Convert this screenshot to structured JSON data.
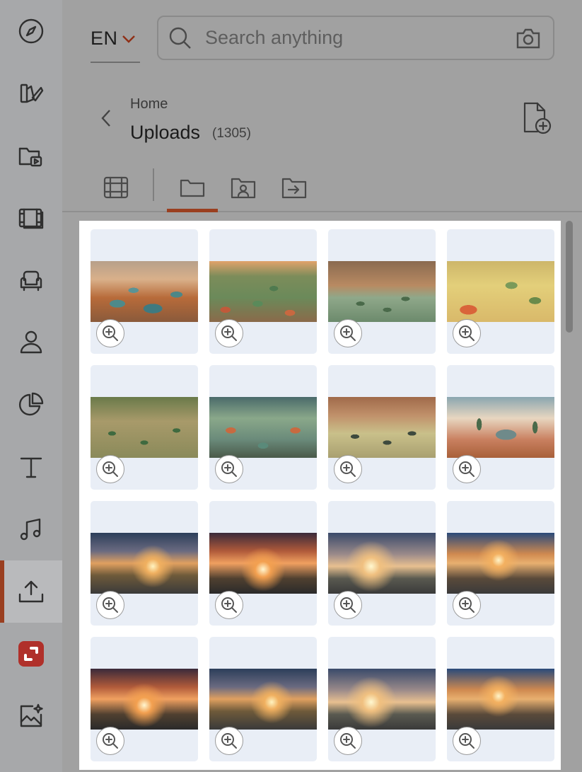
{
  "rail": {
    "items": [
      {
        "name": "explore-icon"
      },
      {
        "name": "design-icon"
      },
      {
        "name": "media-folder-icon"
      },
      {
        "name": "film-icon"
      },
      {
        "name": "armchair-icon"
      },
      {
        "name": "person-icon"
      },
      {
        "name": "pie-chart-icon"
      },
      {
        "name": "text-icon"
      },
      {
        "name": "music-icon"
      },
      {
        "name": "upload-icon",
        "active": true
      },
      {
        "name": "brand-logo-icon"
      },
      {
        "name": "ai-image-icon"
      }
    ]
  },
  "header": {
    "language": "EN",
    "search_placeholder": "Search anything"
  },
  "breadcrumb": {
    "parent": "Home",
    "title": "Uploads",
    "count": "(1305)"
  },
  "tabs": [
    {
      "name": "grid-view-icon"
    },
    {
      "name": "folder-icon",
      "active": true
    },
    {
      "name": "shared-folder-icon"
    },
    {
      "name": "move-to-folder-icon"
    }
  ],
  "colors": {
    "accent": "#9a3f20",
    "card_bg": "#e9eef6"
  },
  "thumbnails": [
    {
      "scene": "mine-a"
    },
    {
      "scene": "mine-b"
    },
    {
      "scene": "mine-c"
    },
    {
      "scene": "mine-d"
    },
    {
      "scene": "mine-e"
    },
    {
      "scene": "mine-f"
    },
    {
      "scene": "mine-g"
    },
    {
      "scene": "mine-h"
    },
    {
      "scene": "sky-a"
    },
    {
      "scene": "sky-b"
    },
    {
      "scene": "sky-c"
    },
    {
      "scene": "sky-d"
    },
    {
      "scene": "sky-b"
    },
    {
      "scene": "sky-a"
    },
    {
      "scene": "sky-c"
    },
    {
      "scene": "sky-d"
    }
  ]
}
